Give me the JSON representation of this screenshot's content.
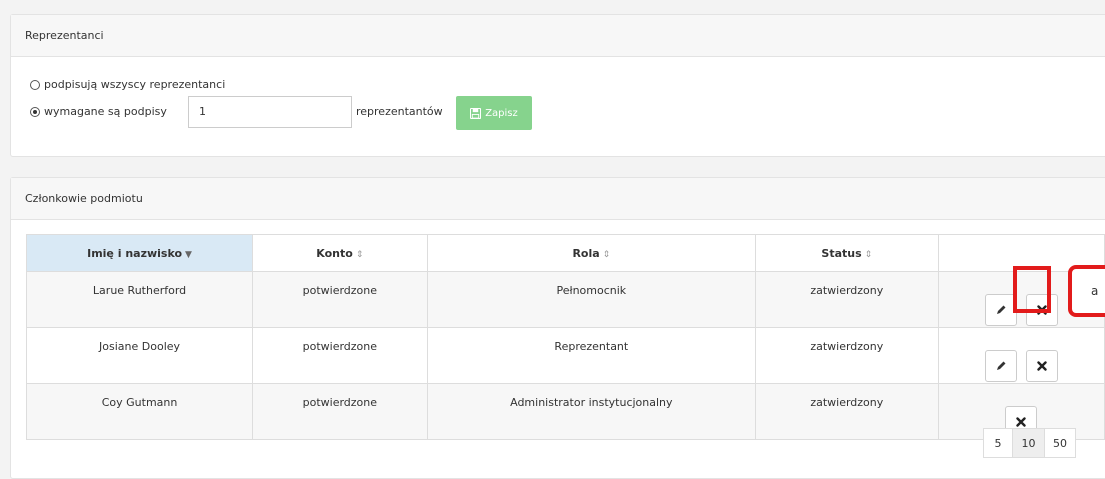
{
  "representatives": {
    "title": "Reprezentanci",
    "option_all_label": "podpisują wszyscy reprezentanci",
    "option_required_label": "wymagane są podpisy",
    "required_count_value": "1",
    "after_input_label": "reprezentantów",
    "save_label": "Zapisz"
  },
  "members": {
    "title": "Członkowie podmiotu",
    "columns": [
      "Imię i nazwisko",
      "Konto",
      "Rola",
      "Status"
    ],
    "rows": [
      {
        "name": "Larue Rutherford",
        "account": "potwierdzone",
        "role": "Pełnomocnik",
        "status": "zatwierdzony"
      },
      {
        "name": "Josiane Dooley",
        "account": "potwierdzone",
        "role": "Reprezentant",
        "status": "zatwierdzony"
      },
      {
        "name": "Coy Gutmann",
        "account": "potwierdzone",
        "role": "Administrator instytucjonalny",
        "status": "zatwierdzony"
      }
    ]
  },
  "pagination": {
    "page_sizes": [
      "5",
      "10",
      "50"
    ],
    "active_page_size": "10"
  },
  "overlay": {
    "partial_button_text": "a"
  },
  "colors": {
    "save_button": "#86d38d",
    "highlight": "#e21b1b",
    "sorted_header": "#d9e9f5"
  },
  "icons": {
    "save": "floppy-disk-icon",
    "edit": "pencil-icon",
    "delete": "times-icon",
    "sort_desc": "caret-down-icon",
    "sort_both": "sort-icon"
  }
}
